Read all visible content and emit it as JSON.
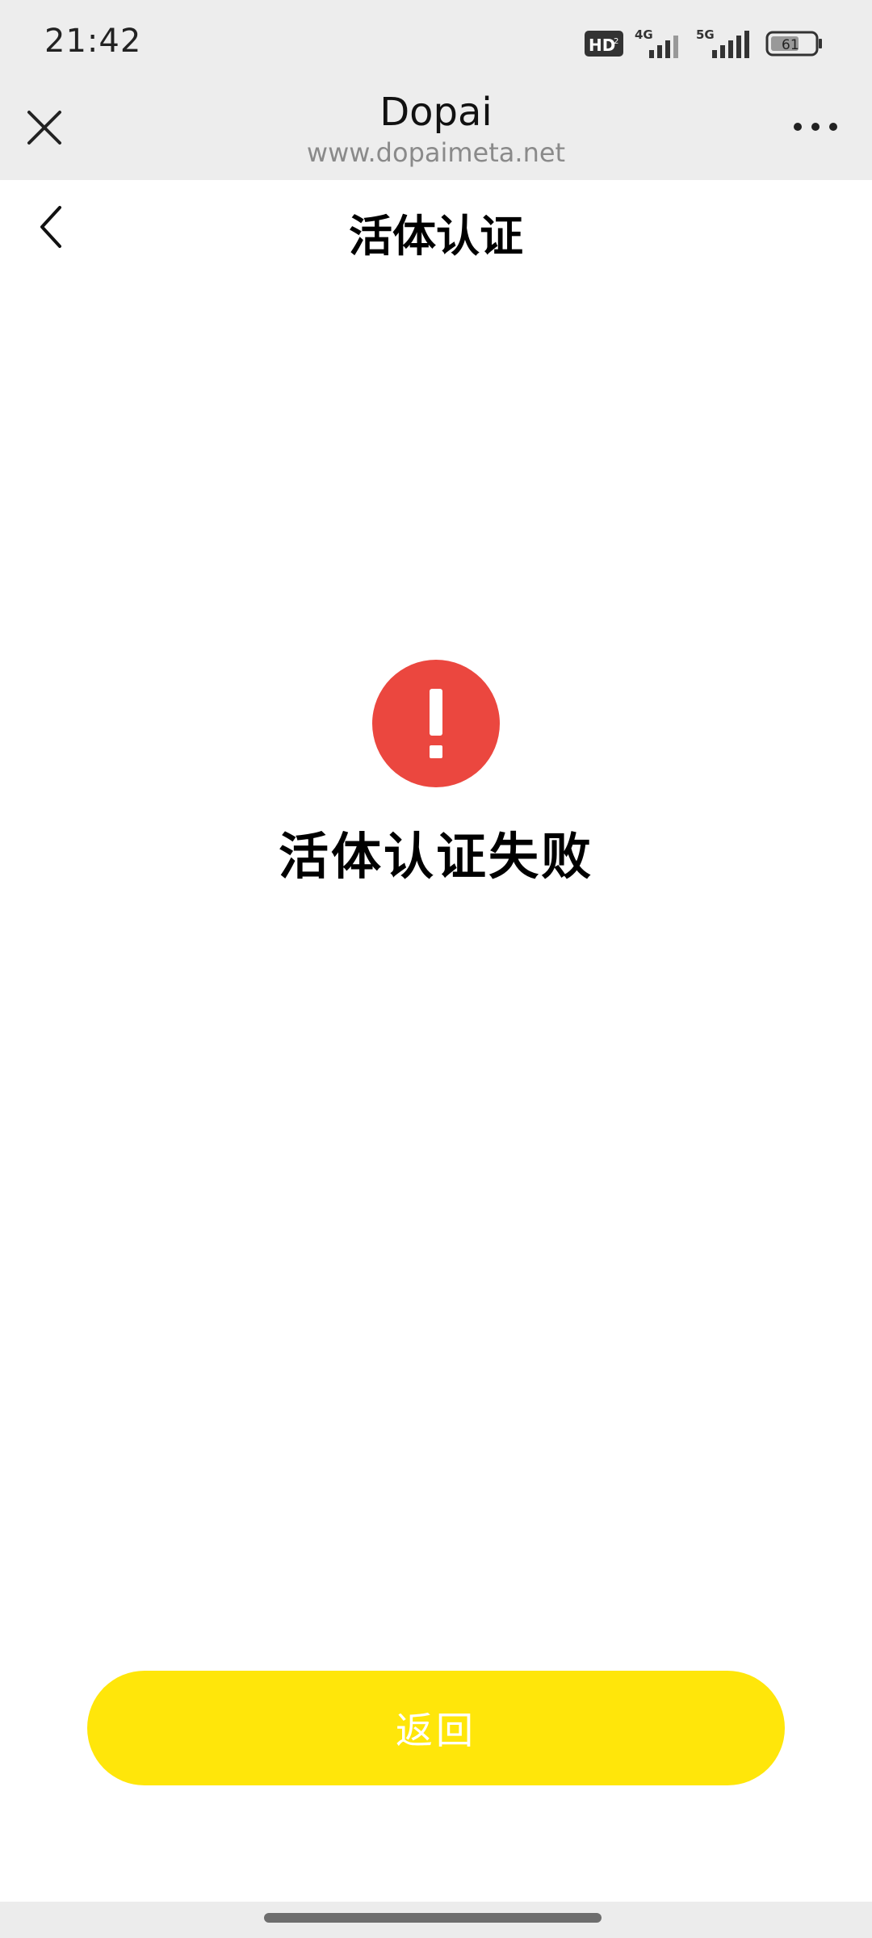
{
  "status_bar": {
    "time": "21:42",
    "hd_badge": "HD",
    "hd_sub": "2",
    "network_1": "4G",
    "network_2": "5G",
    "battery_level": "61"
  },
  "browser": {
    "title": "Dopai",
    "url": "www.dopaimeta.net"
  },
  "page": {
    "title": "活体认证"
  },
  "result": {
    "icon": "exclamation-circle-icon",
    "icon_color": "#eb473f",
    "message": "活体认证失败"
  },
  "actions": {
    "return_label": "返回",
    "button_color": "#ffe60a"
  }
}
